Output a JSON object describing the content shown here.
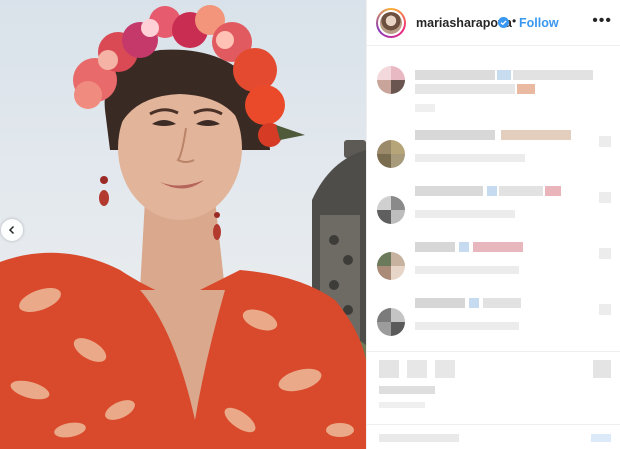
{
  "header": {
    "username": "mariasharapova",
    "separator": "•",
    "follow_label": "Follow",
    "more_label": "•••"
  },
  "icons": {
    "verified": "verified-badge-icon",
    "more": "more-options-icon",
    "prev": "chevron-left-icon",
    "heart": "heart-icon"
  },
  "colors": {
    "accent": "#3897f0",
    "text": "#262626",
    "border": "#efefef"
  }
}
